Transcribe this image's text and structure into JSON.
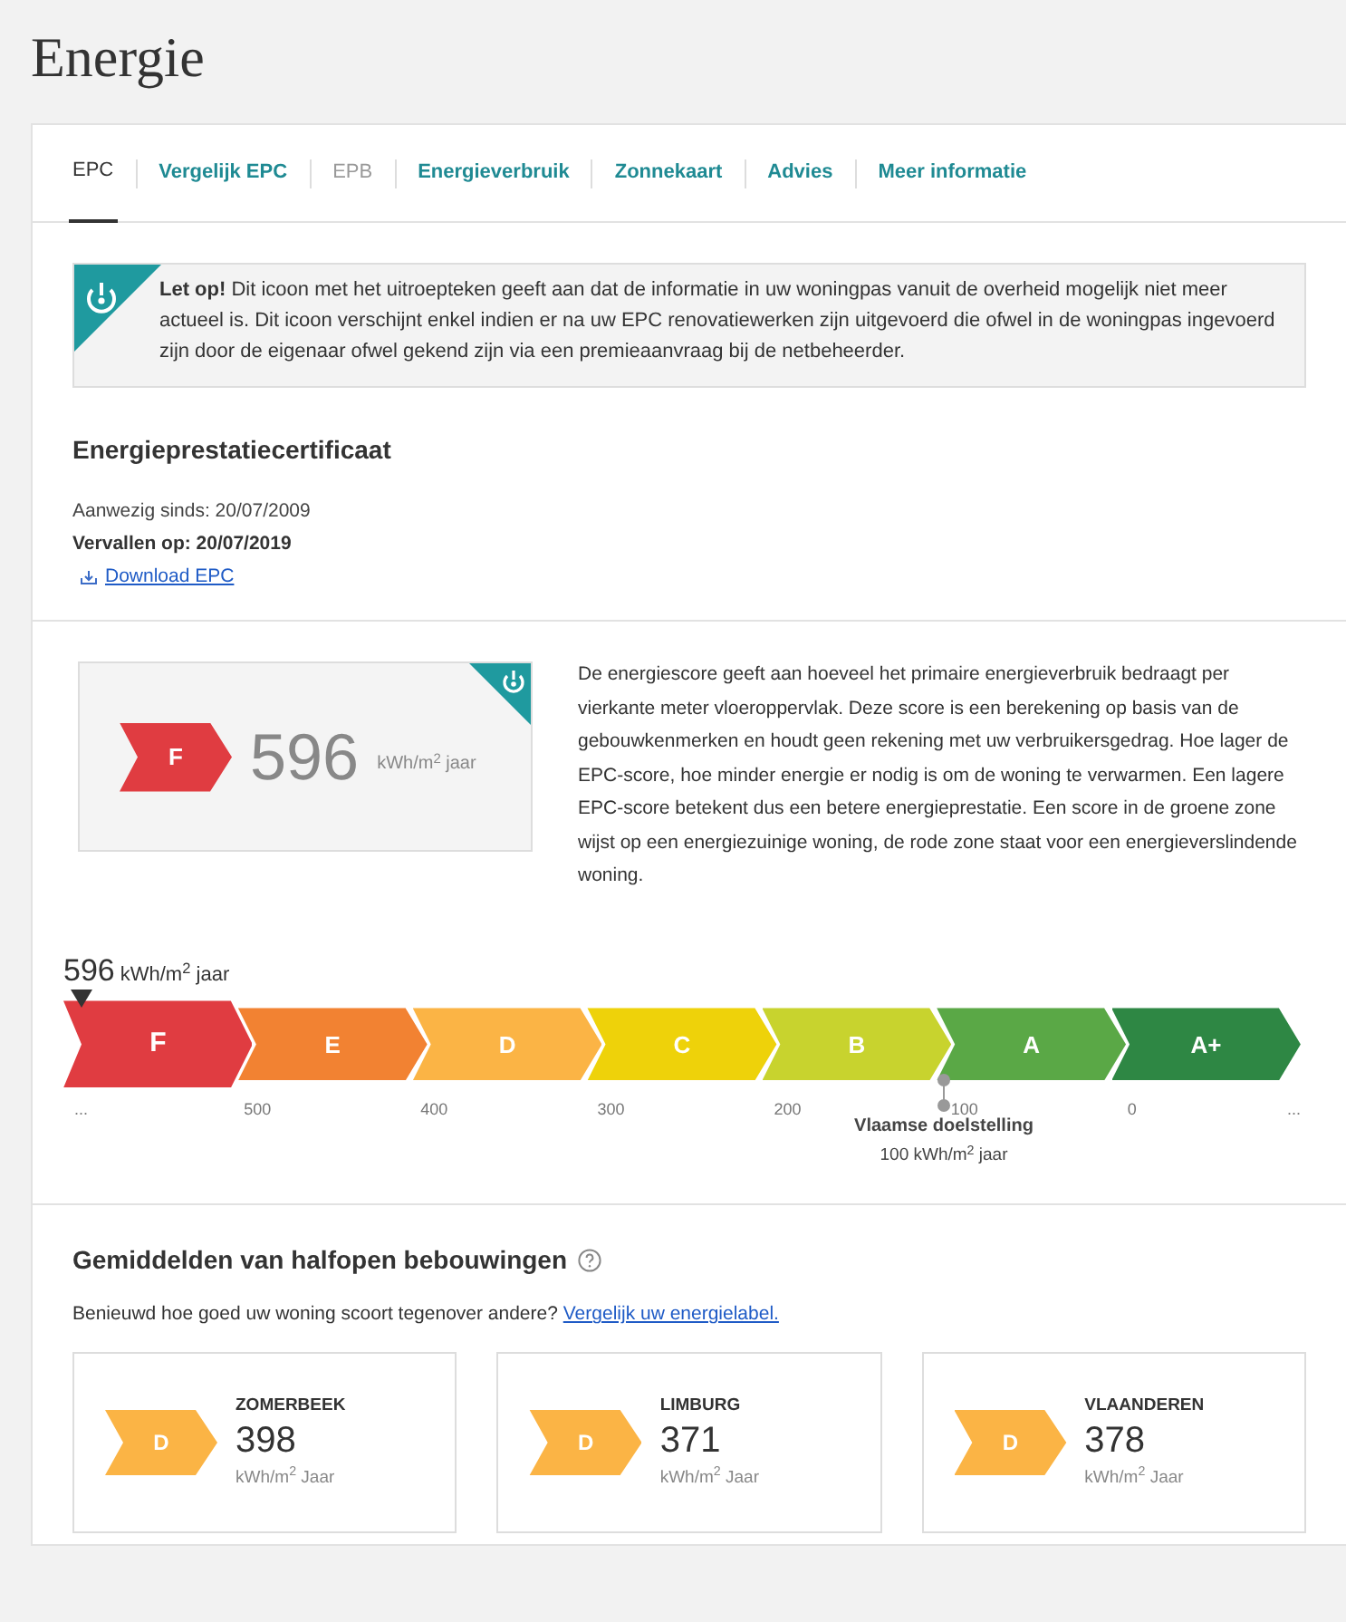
{
  "page_title": "Energie",
  "tabs": [
    {
      "label": "EPC",
      "selected": true,
      "disabled": false
    },
    {
      "label": "Vergelijk EPC",
      "selected": false,
      "disabled": false
    },
    {
      "label": "EPB",
      "selected": false,
      "disabled": true
    },
    {
      "label": "Energieverbruik",
      "selected": false,
      "disabled": false
    },
    {
      "label": "Zonnekaart",
      "selected": false,
      "disabled": false
    },
    {
      "label": "Advies",
      "selected": false,
      "disabled": false
    },
    {
      "label": "Meer informatie",
      "selected": false,
      "disabled": false
    }
  ],
  "alert": {
    "text": "**Let op!** Dit icoon met het uitroepteken geeft aan dat de informatie in uw woningpas vanuit de overheid mogelijk niet meer actueel is. Dit icoon verschijnt enkel indien er na uw EPC renovatiewerken zijn uitgevoerd die ofwel in de woningpas ingevoerd zijn door de eigenaar ofwel gekend zijn via een premieaanvraag bij de netbeheerder."
  },
  "certificate": {
    "heading": "Energieprestatiecertificaat",
    "present_since": "Aanwezig sinds: 20/07/2009",
    "expires": "Vervallen op: 20/07/2019",
    "download_link": "Download EPC"
  },
  "score_card": {
    "grade": "F",
    "color": "#e03c41",
    "value": "596",
    "unit": "kWh/m$^{2}$ jaar",
    "outdated": true
  },
  "score_description": "De energiescore geeft aan hoeveel het primaire energieverbruik bedraagt per vierkante meter vloeroppervlak. Deze score is een berekening op basis van de gebouwkenmerken en houdt geen rekening met uw verbruikersgedrag. Hoe lager de EPC-score, hoe minder energie er nodig is om de woning te verwarmen. Een lagere EPC-score betekent dus een betere energieprestatie. Een score in de groene zone wijst op een energiezuinige woning, de rode zone staat voor een energieverslindende woning.",
  "scale": {
    "value": "596",
    "unit": "kWh/m$^{2}$ jaar",
    "segments": [
      {
        "label": "F",
        "color": "#e03c41",
        "selected": true
      },
      {
        "label": "E",
        "color": "#f28232",
        "selected": false
      },
      {
        "label": "D",
        "color": "#fbb445",
        "selected": false
      },
      {
        "label": "C",
        "color": "#eed20a",
        "selected": false
      },
      {
        "label": "B",
        "color": "#c8d32e",
        "selected": false
      },
      {
        "label": "A",
        "color": "#5aa846",
        "selected": false
      },
      {
        "label": "A+",
        "color": "#2e8744",
        "selected": false
      }
    ],
    "ticks": [
      "...",
      "500",
      "400",
      "300",
      "200",
      "100",
      "0",
      "..."
    ],
    "target_label": "Vlaamse doelstelling",
    "target_value": "100 kWh/m$^{2}$ jaar"
  },
  "averages": {
    "heading": "Gemiddelden van halfopen bebouwingen",
    "intro": "Benieuwd hoe goed uw woning scoort tegenover andere?",
    "link": "Vergelijk uw energielabel.",
    "cards": [
      {
        "region": "ZOMERBEEK",
        "grade": "D",
        "color": "#fbb445",
        "value": "398",
        "unit": "kWh/m$^{2}$ Jaar"
      },
      {
        "region": "LIMBURG",
        "grade": "D",
        "color": "#fbb445",
        "value": "371",
        "unit": "kWh/m$^{2}$ Jaar"
      },
      {
        "region": "VLAANDEREN",
        "grade": "D",
        "color": "#fbb445",
        "value": "378",
        "unit": "kWh/m$^{2}$ Jaar"
      }
    ]
  }
}
